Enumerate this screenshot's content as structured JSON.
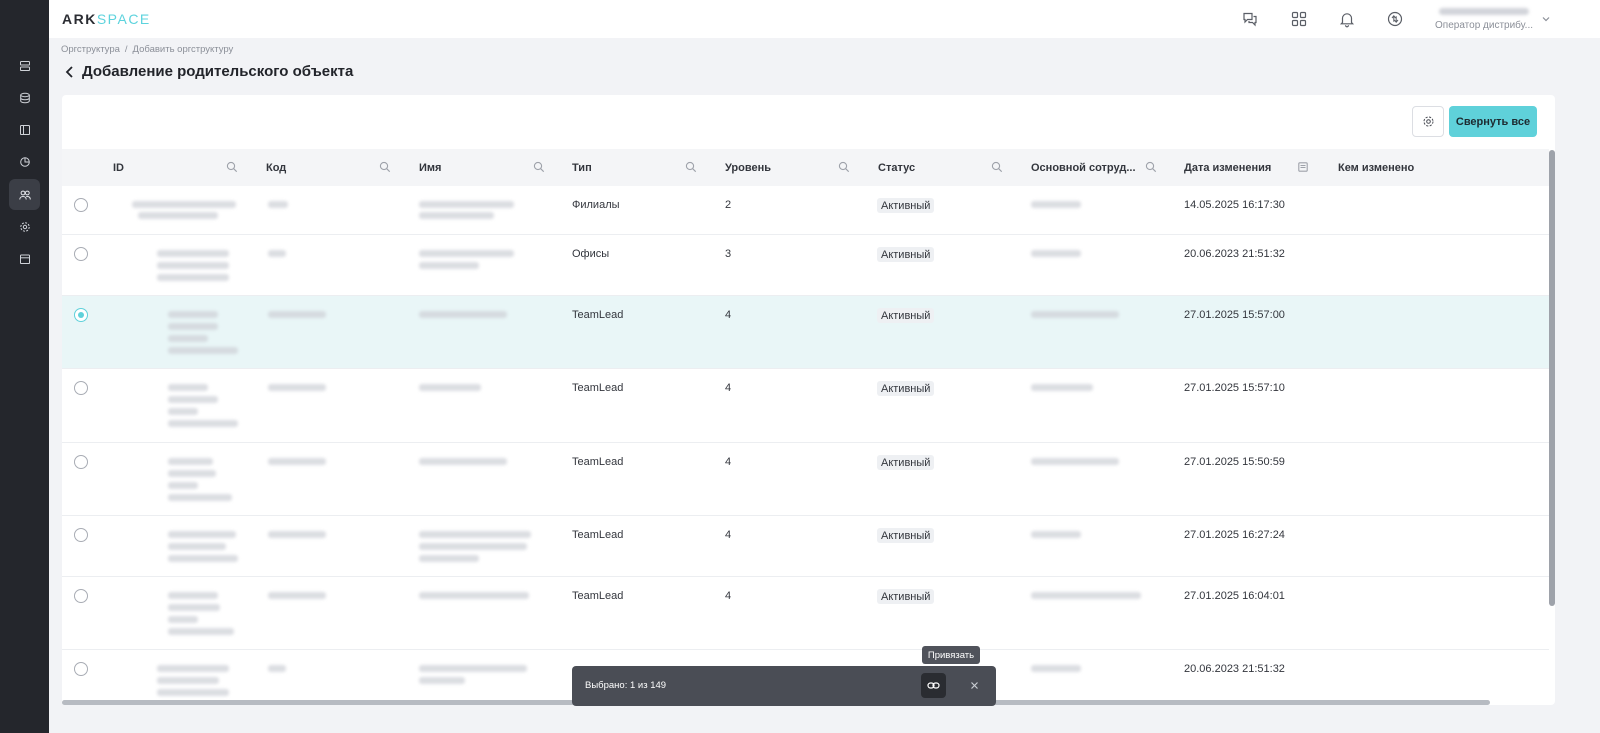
{
  "app": {
    "logo_part1": "ARK",
    "logo_part2": "SPACE"
  },
  "header": {
    "user_role": "Оператор дистрибу..."
  },
  "breadcrumb": {
    "items": [
      "Оргструктура",
      "Добавить оргструктуру"
    ],
    "separator": "/"
  },
  "page": {
    "title": "Добавление родительского объекта"
  },
  "toolbar": {
    "collapse_label": "Свернуть все"
  },
  "table": {
    "columns": {
      "id": "ID",
      "code": "Код",
      "name": "Имя",
      "type": "Тип",
      "level": "Уровень",
      "status": "Статус",
      "employee": "Основной сотруд...",
      "modified_date": "Дата изменения",
      "modified_by": "Кем изменено"
    },
    "rows": [
      {
        "type": "Филиалы",
        "level": "2",
        "status": "Активный",
        "modified_date": "14.05.2025 16:17:30",
        "selected": false
      },
      {
        "type": "Офисы",
        "level": "3",
        "status": "Активный",
        "modified_date": "20.06.2023 21:51:32",
        "selected": false
      },
      {
        "type": "TeamLead",
        "level": "4",
        "status": "Активный",
        "modified_date": "27.01.2025 15:57:00",
        "selected": true
      },
      {
        "type": "TeamLead",
        "level": "4",
        "status": "Активный",
        "modified_date": "27.01.2025 15:57:10",
        "selected": false
      },
      {
        "type": "TeamLead",
        "level": "4",
        "status": "Активный",
        "modified_date": "27.01.2025 15:50:59",
        "selected": false
      },
      {
        "type": "TeamLead",
        "level": "4",
        "status": "Активный",
        "modified_date": "27.01.2025 16:27:24",
        "selected": false
      },
      {
        "type": "TeamLead",
        "level": "4",
        "status": "Активный",
        "modified_date": "27.01.2025 16:04:01",
        "selected": false
      },
      {
        "type": "",
        "level": "",
        "status": "",
        "modified_date": "20.06.2023 21:51:32",
        "selected": false
      }
    ]
  },
  "actionbar": {
    "selected_text": "Выбрано: 1 из 149",
    "tooltip": "Привязать"
  },
  "colors": {
    "accent": "#5fd1da",
    "sidebar": "#24262c",
    "selected_row": "#e9f6f7"
  }
}
